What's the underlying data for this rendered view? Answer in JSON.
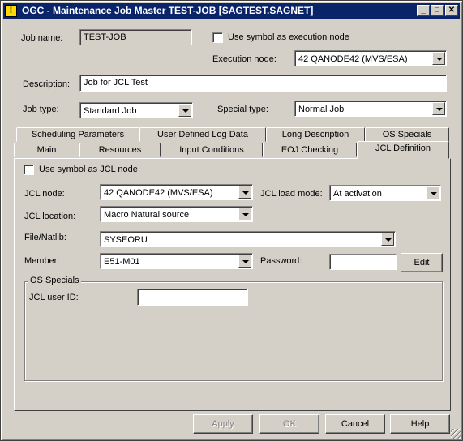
{
  "window": {
    "title": "OGC - Maintenance Job Master TEST-JOB [SAGTEST.SAGNET]",
    "app_icon": "!",
    "minimize_glyph": "_",
    "maximize_glyph": "□",
    "close_glyph": "✕"
  },
  "header": {
    "job_name_label": "Job name:",
    "job_name_value": "TEST-JOB",
    "use_symbol_exec_label": "Use symbol as execution node",
    "execution_node_label": "Execution node:",
    "execution_node_value": "42     QANODE42 (MVS/ESA)",
    "description_label": "Description:",
    "description_value": "Job for JCL Test",
    "job_type_label": "Job type:",
    "job_type_value": "Standard Job",
    "special_type_label": "Special type:",
    "special_type_value": "Normal Job"
  },
  "tabs_row1": [
    "Scheduling Parameters",
    "User Defined Log Data",
    "Long Description",
    "OS Specials"
  ],
  "tabs_row2": [
    "Main",
    "Resources",
    "Input Conditions",
    "EOJ Checking",
    "JCL Definition"
  ],
  "jcl": {
    "use_symbol_jcl_label": "Use symbol as JCL node",
    "jcl_node_label": "JCL node:",
    "jcl_node_value": "42     QANODE42 (MVS/ESA)",
    "jcl_load_mode_label": "JCL load mode:",
    "jcl_load_mode_value": "At activation",
    "jcl_location_label": "JCL location:",
    "jcl_location_value": "Macro Natural source",
    "file_natlib_label": "File/Natlib:",
    "file_natlib_value": "SYSEORU",
    "member_label": "Member:",
    "member_value": "E51-M01",
    "password_label": "Password:",
    "password_value": "",
    "edit_label": "Edit",
    "os_specials_title": "OS Specials",
    "jcl_user_id_label": "JCL user ID:",
    "jcl_user_id_value": ""
  },
  "footer": {
    "apply": "Apply",
    "ok": "OK",
    "cancel": "Cancel",
    "help": "Help"
  }
}
